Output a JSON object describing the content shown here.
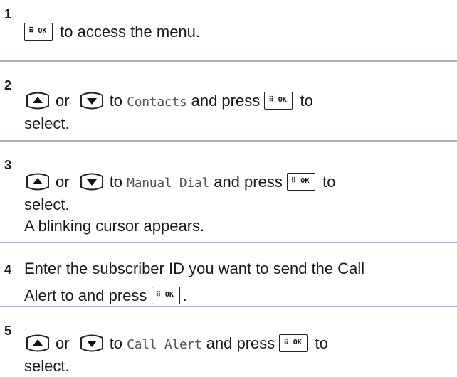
{
  "icons": {
    "ok_key": "menu-ok-key-icon",
    "up_key": "up-arrow-key-icon",
    "down_key": "down-arrow-key-icon",
    "ok_key_glyph": "⠿ OK"
  },
  "steps": [
    {
      "number": "1",
      "text_after_ok": "to access the menu."
    },
    {
      "number": "2",
      "or": "or",
      "to": "to",
      "menu_item": "Contacts",
      "and_press": "and press",
      "to2": "to",
      "line2": "select."
    },
    {
      "number": "3",
      "or": "or",
      "to": "to",
      "menu_item": "Manual Dial",
      "and_press": "and press",
      "to2": "to",
      "line2": "select.",
      "line3": "A blinking cursor appears."
    },
    {
      "number": "4",
      "line1": "Enter the subscriber ID you want to send the Call",
      "line2_before_ok": "Alert to and press",
      "line2_after_ok": "."
    },
    {
      "number": "5",
      "or": "or",
      "to": "to",
      "menu_item": "Call Alert",
      "and_press": "and press",
      "to2": "to",
      "line2": "select."
    }
  ]
}
